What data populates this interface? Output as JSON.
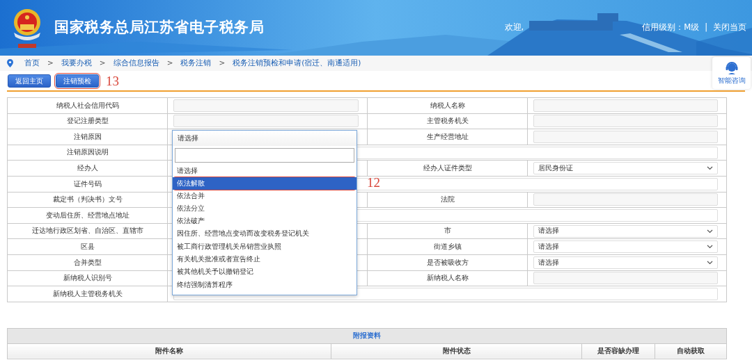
{
  "header": {
    "title": "国家税务总局江苏省电子税务局",
    "welcome": "欢迎,",
    "credit_level": "信用级别：M级",
    "separator": "|",
    "close_link": "关闭当页"
  },
  "breadcrumb": {
    "separator": ">",
    "items": [
      "首页",
      "我要办税",
      "综合信息报告",
      "税务注销",
      "税务注销预检和申请(宿迁、南通适用)"
    ]
  },
  "assistant": {
    "label": "智能咨询"
  },
  "buttons": [
    {
      "label": "返回主页",
      "annotated": false
    },
    {
      "label": "注销预检",
      "annotated": true
    }
  ],
  "button_annotation": "13",
  "form": {
    "rows": [
      {
        "cells": [
          {
            "kind": "label",
            "text": "纳税人社会信用代码"
          },
          {
            "kind": "input"
          },
          {
            "kind": "label",
            "text": "纳税人名称"
          },
          {
            "kind": "input"
          }
        ]
      },
      {
        "cells": [
          {
            "kind": "label",
            "text": "登记注册类型"
          },
          {
            "kind": "input"
          },
          {
            "kind": "label",
            "text": "主管税务机关"
          },
          {
            "kind": "input"
          }
        ]
      },
      {
        "cells": [
          {
            "kind": "label",
            "text": "注销原因"
          },
          {
            "kind": "label",
            "text": "生产经营地址"
          },
          {
            "kind": "input"
          }
        ]
      },
      {
        "cells": [
          {
            "kind": "label",
            "text": "注销原因说明"
          },
          {
            "kind": "wide"
          }
        ]
      },
      {
        "cells": [
          {
            "kind": "label",
            "text": "经办人"
          },
          {
            "kind": "label",
            "text": "经办人证件类型"
          },
          {
            "kind": "select",
            "value": "居民身份证"
          }
        ]
      },
      {
        "cells": [
          {
            "kind": "label",
            "text": "证件号码"
          },
          {
            "kind": "wide"
          }
        ]
      },
      {
        "cells": [
          {
            "kind": "label",
            "text": "裁定书（判决书）文号"
          },
          {
            "kind": "label",
            "text": "法院"
          },
          {
            "kind": "input"
          }
        ]
      },
      {
        "cells": [
          {
            "kind": "label",
            "text": "变动后住所、经营地点地址"
          },
          {
            "kind": "wide"
          }
        ]
      },
      {
        "cells": [
          {
            "kind": "label",
            "text": "迁达地行政区划省、自治区、直辖市"
          },
          {
            "kind": "label",
            "text": "市"
          },
          {
            "kind": "select",
            "value": "请选择"
          }
        ]
      },
      {
        "cells": [
          {
            "kind": "label",
            "text": "区县"
          },
          {
            "kind": "label",
            "text": "街道乡镇"
          },
          {
            "kind": "select",
            "value": "请选择"
          }
        ]
      },
      {
        "cells": [
          {
            "kind": "label",
            "text": "合并类型"
          },
          {
            "kind": "label",
            "text": "是否被吸收方"
          },
          {
            "kind": "select",
            "value": "请选择"
          }
        ]
      },
      {
        "cells": [
          {
            "kind": "label",
            "text": "新纳税人识别号"
          },
          {
            "kind": "label",
            "text": "新纳税人名称"
          },
          {
            "kind": "input"
          }
        ]
      },
      {
        "cells": [
          {
            "kind": "label",
            "text": "新纳税人主管税务机关"
          },
          {
            "kind": "wide"
          }
        ]
      }
    ]
  },
  "dropdown": {
    "header": "请选择",
    "options": [
      {
        "label": "请选择",
        "selected": false,
        "annotated": false
      },
      {
        "label": "依法解散",
        "selected": true,
        "annotated": true
      },
      {
        "label": "依法合并",
        "selected": false,
        "annotated": false
      },
      {
        "label": "依法分立",
        "selected": false,
        "annotated": false
      },
      {
        "label": "依法破产",
        "selected": false,
        "annotated": false
      },
      {
        "label": "因住所、经营地点变动而改变税务登记机关",
        "selected": false,
        "annotated": false
      },
      {
        "label": "被工商行政管理机关吊销营业执照",
        "selected": false,
        "annotated": false
      },
      {
        "label": "有关机关批准或者宣告终止",
        "selected": false,
        "annotated": false
      },
      {
        "label": "被其他机关予以撤销登记",
        "selected": false,
        "annotated": false
      },
      {
        "label": "终结强制清算程序",
        "selected": false,
        "annotated": false
      }
    ],
    "annotation": "12"
  },
  "attachments": {
    "title": "附报资料",
    "columns": [
      "附件名称",
      "附件状态",
      "是否容缺办理",
      "自动获取"
    ]
  }
}
